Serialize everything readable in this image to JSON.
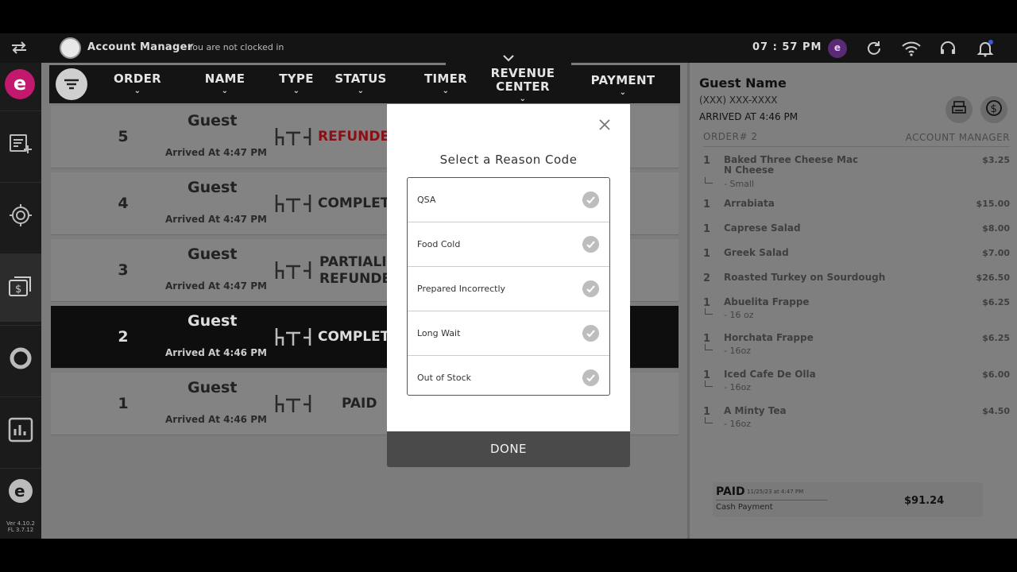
{
  "topbar": {
    "account": "Account Manager",
    "clock_status": "You are not clocked in",
    "time": "07 : 57 PM",
    "user_initial": "e"
  },
  "rail": {
    "brand_letter": "e",
    "version": "Ver 4.10.2",
    "fl_version": "FL 3.7.12"
  },
  "orders_header": {
    "columns": [
      "ORDER",
      "NAME",
      "TYPE",
      "STATUS",
      "TIMER",
      "REVENUE CENTER",
      "PAYMENT"
    ]
  },
  "orders": [
    {
      "number": "5",
      "name": "Guest",
      "arrived": "Arrived At 4:47 PM",
      "status": "REFUNDE"
    },
    {
      "number": "4",
      "name": "Guest",
      "arrived": "Arrived At 4:47 PM",
      "status": "COMPLETI"
    },
    {
      "number": "3",
      "name": "Guest",
      "arrived": "Arrived At 4:47 PM",
      "status_line1": "PARTIALI",
      "status_line2": "REFUNDE"
    },
    {
      "number": "2",
      "name": "Guest",
      "arrived": "Arrived At 4:46 PM",
      "status": "COMPLETI"
    },
    {
      "number": "1",
      "name": "Guest",
      "arrived": "Arrived At 4:46 PM",
      "status": "PAID"
    }
  ],
  "summary": {
    "guest_name": "Guest Name",
    "phone": "(XXX) XXX-XXXX",
    "arrived": "ARRIVED AT 4:46 PM",
    "order_label": "ORDER# 2",
    "manager_label": "ACCOUNT MANAGER",
    "items": [
      {
        "qty": "1",
        "name": "Baked Three Cheese Mac N Cheese",
        "price": "$3.25",
        "modifier": "- Small"
      },
      {
        "qty": "1",
        "name": "Arrabiata",
        "price": "$15.00"
      },
      {
        "qty": "1",
        "name": "Caprese Salad",
        "price": "$8.00"
      },
      {
        "qty": "1",
        "name": "Greek Salad",
        "price": "$7.00"
      },
      {
        "qty": "2",
        "name": "Roasted Turkey on Sourdough",
        "price": "$26.50"
      },
      {
        "qty": "1",
        "name": "Abuelita Frappe",
        "price": "$6.25",
        "modifier": "- 16 oz"
      },
      {
        "qty": "1",
        "name": "Horchata Frappe",
        "price": "$6.25",
        "modifier": "- 16oz"
      },
      {
        "qty": "1",
        "name": "Iced Cafe De Olla",
        "price": "$6.00",
        "modifier": "- 16oz"
      },
      {
        "qty": "1",
        "name": "A Minty Tea",
        "price": "$4.50",
        "modifier": "- 16oz"
      }
    ],
    "paid_label": "PAID",
    "paid_date": "11/25/23 at 4:47 PM",
    "payment_method": "Cash Payment",
    "total": "$91.24"
  },
  "modal": {
    "title": "Select a Reason Code",
    "reasons": [
      "QSA",
      "Food Cold",
      "Prepared Incorrectly",
      "Long Wait",
      "Out of Stock"
    ],
    "done_label": "DONE"
  }
}
